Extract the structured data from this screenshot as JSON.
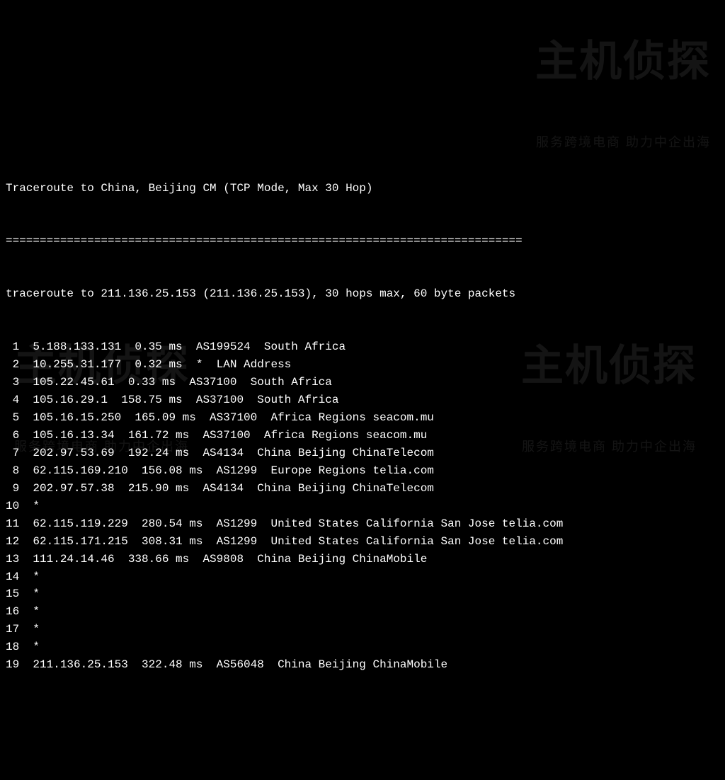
{
  "header": "Traceroute to China, Beijing CM (TCP Mode, Max 30 Hop)",
  "separator": "============================================================================",
  "subheader": "traceroute to 211.136.25.153 (211.136.25.153), 30 hops max, 60 byte packets",
  "hops": [
    {
      "n": " 1",
      "ip": "5.188.133.131",
      "rtt": "0.35 ms",
      "asn": "AS199524",
      "loc": "South Africa"
    },
    {
      "n": " 2",
      "ip": "10.255.31.177",
      "rtt": "0.32 ms",
      "asn": "*",
      "loc": "LAN Address"
    },
    {
      "n": " 3",
      "ip": "105.22.45.61",
      "rtt": "0.33 ms",
      "asn": "AS37100",
      "loc": "South Africa"
    },
    {
      "n": " 4",
      "ip": "105.16.29.1",
      "rtt": "158.75 ms",
      "asn": "AS37100",
      "loc": "South Africa"
    },
    {
      "n": " 5",
      "ip": "105.16.15.250",
      "rtt": "165.09 ms",
      "asn": "AS37100",
      "loc": "Africa Regions seacom.mu"
    },
    {
      "n": " 6",
      "ip": "105.16.13.34",
      "rtt": "161.72 ms",
      "asn": "AS37100",
      "loc": "Africa Regions seacom.mu"
    },
    {
      "n": " 7",
      "ip": "202.97.53.69",
      "rtt": "192.24 ms",
      "asn": "AS4134",
      "loc": "China Beijing ChinaTelecom"
    },
    {
      "n": " 8",
      "ip": "62.115.169.210",
      "rtt": "156.08 ms",
      "asn": "AS1299",
      "loc": "Europe Regions telia.com"
    },
    {
      "n": " 9",
      "ip": "202.97.57.38",
      "rtt": "215.90 ms",
      "asn": "AS4134",
      "loc": "China Beijing ChinaTelecom"
    },
    {
      "n": "10",
      "ip": "*",
      "rtt": "",
      "asn": "",
      "loc": ""
    },
    {
      "n": "11",
      "ip": "62.115.119.229",
      "rtt": "280.54 ms",
      "asn": "AS1299",
      "loc": "United States California San Jose telia.com"
    },
    {
      "n": "12",
      "ip": "62.115.171.215",
      "rtt": "308.31 ms",
      "asn": "AS1299",
      "loc": "United States California San Jose telia.com"
    },
    {
      "n": "13",
      "ip": "111.24.14.46",
      "rtt": "338.66 ms",
      "asn": "AS9808",
      "loc": "China Beijing ChinaMobile"
    },
    {
      "n": "14",
      "ip": "*",
      "rtt": "",
      "asn": "",
      "loc": ""
    },
    {
      "n": "15",
      "ip": "*",
      "rtt": "",
      "asn": "",
      "loc": ""
    },
    {
      "n": "16",
      "ip": "*",
      "rtt": "",
      "asn": "",
      "loc": ""
    },
    {
      "n": "17",
      "ip": "*",
      "rtt": "",
      "asn": "",
      "loc": ""
    },
    {
      "n": "18",
      "ip": "*",
      "rtt": "",
      "asn": "",
      "loc": ""
    },
    {
      "n": "19",
      "ip": "211.136.25.153",
      "rtt": "322.48 ms",
      "asn": "AS56048",
      "loc": "China Beijing ChinaMobile"
    }
  ],
  "watermark": {
    "main": "主机侦探",
    "sub": "服务跨境电商 助力中企出海"
  }
}
